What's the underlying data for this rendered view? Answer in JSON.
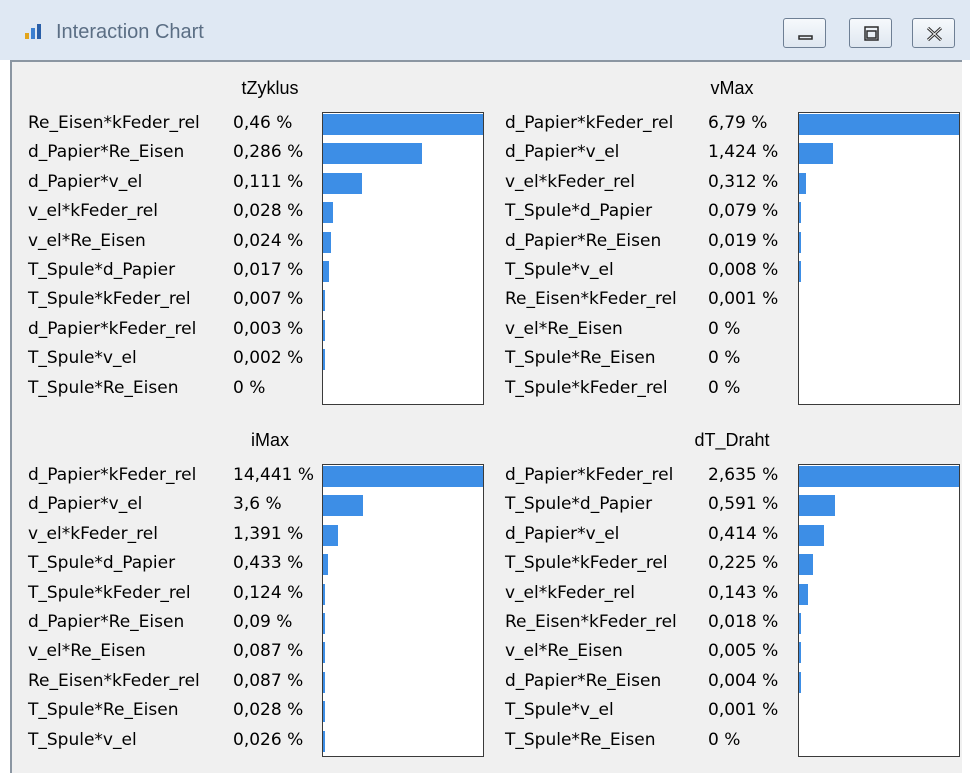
{
  "window": {
    "title": "Interaction Chart",
    "buttons": {
      "minimize": "minimize-icon",
      "restore": "restore-icon",
      "close": "close-icon"
    }
  },
  "colors": {
    "bar": "#3d8ee6",
    "titlebar": "#dfe8f3",
    "background": "#f0f0f0"
  },
  "panels": [
    {
      "title": "tZyklus",
      "rows": [
        {
          "label": "Re_Eisen*kFeder_rel",
          "value": "0,46 %",
          "pct": 0.46
        },
        {
          "label": "d_Papier*Re_Eisen",
          "value": "0,286 %",
          "pct": 0.286
        },
        {
          "label": "d_Papier*v_el",
          "value": "0,111 %",
          "pct": 0.111
        },
        {
          "label": "v_el*kFeder_rel",
          "value": "0,028 %",
          "pct": 0.028
        },
        {
          "label": "v_el*Re_Eisen",
          "value": "0,024 %",
          "pct": 0.024
        },
        {
          "label": "T_Spule*d_Papier",
          "value": "0,017 %",
          "pct": 0.017
        },
        {
          "label": "T_Spule*kFeder_rel",
          "value": "0,007 %",
          "pct": 0.007
        },
        {
          "label": "d_Papier*kFeder_rel",
          "value": "0,003 %",
          "pct": 0.003
        },
        {
          "label": "T_Spule*v_el",
          "value": "0,002 %",
          "pct": 0.002
        },
        {
          "label": "T_Spule*Re_Eisen",
          "value": "0 %",
          "pct": 0
        }
      ]
    },
    {
      "title": "vMax",
      "rows": [
        {
          "label": "d_Papier*kFeder_rel",
          "value": "6,79 %",
          "pct": 6.79
        },
        {
          "label": "d_Papier*v_el",
          "value": "1,424 %",
          "pct": 1.424
        },
        {
          "label": "v_el*kFeder_rel",
          "value": "0,312 %",
          "pct": 0.312
        },
        {
          "label": "T_Spule*d_Papier",
          "value": "0,079 %",
          "pct": 0.079
        },
        {
          "label": "d_Papier*Re_Eisen",
          "value": "0,019 %",
          "pct": 0.019
        },
        {
          "label": "T_Spule*v_el",
          "value": "0,008 %",
          "pct": 0.008
        },
        {
          "label": "Re_Eisen*kFeder_rel",
          "value": "0,001 %",
          "pct": 0.001
        },
        {
          "label": "v_el*Re_Eisen",
          "value": "0 %",
          "pct": 0
        },
        {
          "label": "T_Spule*Re_Eisen",
          "value": "0 %",
          "pct": 0
        },
        {
          "label": "T_Spule*kFeder_rel",
          "value": "0 %",
          "pct": 0
        }
      ]
    },
    {
      "title": "iMax",
      "rows": [
        {
          "label": "d_Papier*kFeder_rel",
          "value": "14,441 %",
          "pct": 14.441
        },
        {
          "label": "d_Papier*v_el",
          "value": "3,6 %",
          "pct": 3.6
        },
        {
          "label": "v_el*kFeder_rel",
          "value": "1,391 %",
          "pct": 1.391
        },
        {
          "label": "T_Spule*d_Papier",
          "value": "0,433 %",
          "pct": 0.433
        },
        {
          "label": "T_Spule*kFeder_rel",
          "value": "0,124 %",
          "pct": 0.124
        },
        {
          "label": "d_Papier*Re_Eisen",
          "value": "0,09 %",
          "pct": 0.09
        },
        {
          "label": "v_el*Re_Eisen",
          "value": "0,087 %",
          "pct": 0.087
        },
        {
          "label": "Re_Eisen*kFeder_rel",
          "value": "0,087 %",
          "pct": 0.087
        },
        {
          "label": "T_Spule*Re_Eisen",
          "value": "0,028 %",
          "pct": 0.028
        },
        {
          "label": "T_Spule*v_el",
          "value": "0,026 %",
          "pct": 0.026
        }
      ]
    },
    {
      "title": "dT_Draht",
      "rows": [
        {
          "label": "d_Papier*kFeder_rel",
          "value": "2,635 %",
          "pct": 2.635
        },
        {
          "label": "T_Spule*d_Papier",
          "value": "0,591 %",
          "pct": 0.591
        },
        {
          "label": "d_Papier*v_el",
          "value": "0,414 %",
          "pct": 0.414
        },
        {
          "label": "T_Spule*kFeder_rel",
          "value": "0,225 %",
          "pct": 0.225
        },
        {
          "label": "v_el*kFeder_rel",
          "value": "0,143 %",
          "pct": 0.143
        },
        {
          "label": "Re_Eisen*kFeder_rel",
          "value": "0,018 %",
          "pct": 0.018
        },
        {
          "label": "v_el*Re_Eisen",
          "value": "0,005 %",
          "pct": 0.005
        },
        {
          "label": "d_Papier*Re_Eisen",
          "value": "0,004 %",
          "pct": 0.004
        },
        {
          "label": "T_Spule*v_el",
          "value": "0,001 %",
          "pct": 0.001
        },
        {
          "label": "T_Spule*Re_Eisen",
          "value": "0 %",
          "pct": 0
        }
      ]
    }
  ]
}
